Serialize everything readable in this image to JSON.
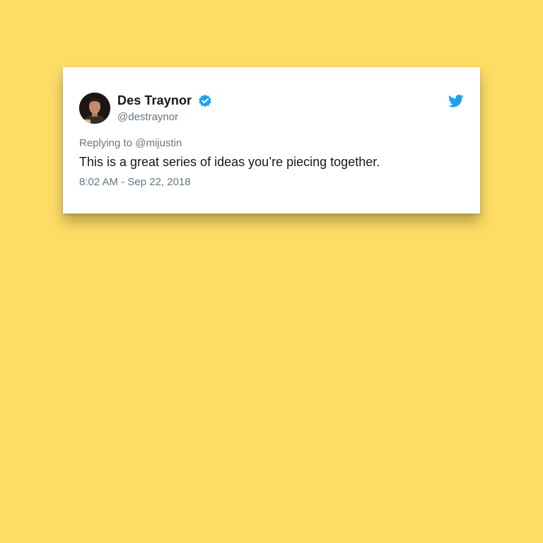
{
  "colors": {
    "background": "#FEDD66",
    "card": "#FFFFFF",
    "twitter_blue": "#1DA1F2",
    "text_primary": "#14171A",
    "text_secondary": "#657786"
  },
  "tweet": {
    "author": {
      "display_name": "Des Traynor",
      "handle": "@destraynor",
      "verified": true,
      "avatar_icon": "user-avatar"
    },
    "reply_prefix": "Replying to ",
    "reply_to": "@mijustin",
    "text": "This is a great series of ideas you’re piecing together.",
    "timestamp": "8:02 AM - Sep 22, 2018",
    "brand_icon": "twitter-bird-icon"
  }
}
